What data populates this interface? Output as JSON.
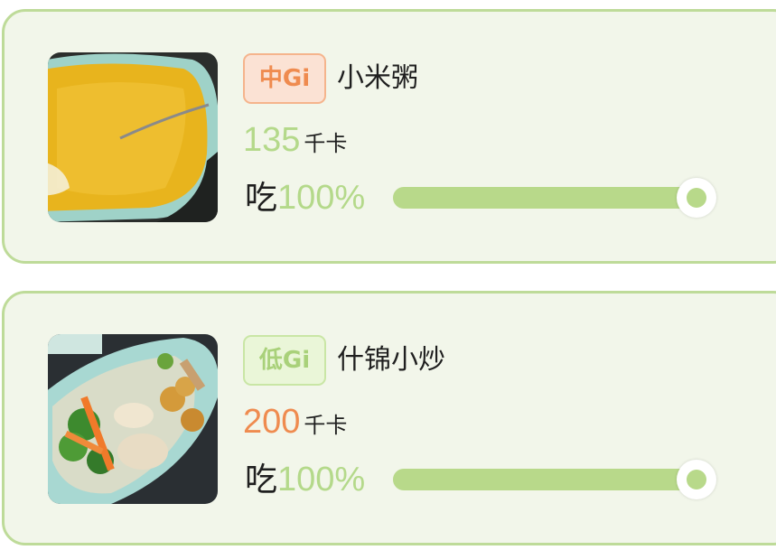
{
  "colors": {
    "card_bg": "#f2f6ea",
    "card_border": "#bedb99",
    "accent_green": "#b8d98a",
    "kcal_green": "#b4d98a",
    "kcal_orange": "#ef8b4f",
    "gi_mid": "#ef8b4f",
    "gi_low": "#a9d17a"
  },
  "foods": [
    {
      "image_icon": "millet-porridge-photo",
      "gi_label": "中Gi",
      "gi_level": "mid",
      "name": "小米粥",
      "kcal_value": "135",
      "kcal_color": "#b4d98a",
      "kcal_unit": "千卡",
      "eat_label": "吃",
      "eat_percent_text": "100%",
      "eat_fraction": 1.0
    },
    {
      "image_icon": "mixed-stir-fry-photo",
      "gi_label": "低Gi",
      "gi_level": "low",
      "name": "什锦小炒",
      "kcal_value": "200",
      "kcal_color": "#ef8b4f",
      "kcal_unit": "千卡",
      "eat_label": "吃",
      "eat_percent_text": "100%",
      "eat_fraction": 1.0
    }
  ]
}
